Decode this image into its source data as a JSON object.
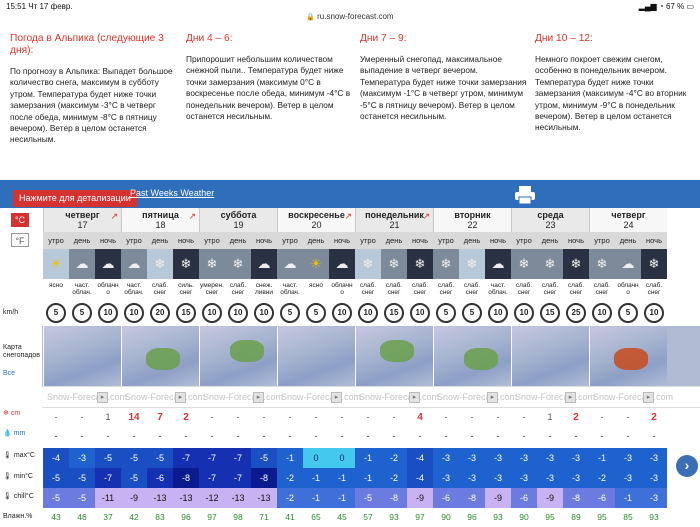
{
  "status": {
    "time": "15:51",
    "date": "Чт 17 февр.",
    "battery": "67 %"
  },
  "url": "ru.snow-forecast.com",
  "intro": [
    {
      "title": "Погода в Альпика (следующие 3 дня):",
      "text": "По прогнозу в Альпика: Выпадет большое количество снега, максимум в субботу утром. Температура будет ниже точки замерзания (максимум -3°C в четверг после обеда, минимум -8°C в пятницу вечером). Ветер в целом останется несильным."
    },
    {
      "title": "Дни 4 – 6:",
      "text": "Припорошит небольшим количеством снежной пыли.. Температура будет ниже точки замерзания (максимум 0°C в воскресенье после обеда, минимум -4°C в понедельник вечером). Ветер в целом останется несильным."
    },
    {
      "title": "Дни 7 – 9:",
      "text": "Умеренный снегопад, максимальное выпадение в четверг вечером. Температура будет ниже точки замерзания (максимум -1°C в четверг утром, минимум -5°C в пятницу вечером). Ветер в целом останется несильным."
    },
    {
      "title": "Дни 10 – 12:",
      "text": "Немного покроет свежим снегом, особенно в понедельник вечером. Температура будет ниже точки замерзания (максимум -4°C во вторник утром, минимум -9°C в понедельник вечером). Ветер в целом останется несильным."
    }
  ],
  "toolbar": {
    "tip": "Нажмите для детализации",
    "past": "Past Weeks Weather"
  },
  "units": {
    "c": "°C",
    "f": "°F"
  },
  "row_labels": {
    "wind": "km/h",
    "map": "Карта снегопадов",
    "map_link": "Все",
    "snow": "cm",
    "rain": "mm",
    "max": "max°C",
    "min": "min°C",
    "chill": "chill°C",
    "hum": "Влажн.%"
  },
  "sf_watermark": "Snow-Forecast.com",
  "days": [
    {
      "name": "четверг",
      "num": "17"
    },
    {
      "name": "пятница",
      "num": "18"
    },
    {
      "name": "суббота",
      "num": "19"
    },
    {
      "name": "воскресенье",
      "num": "20"
    },
    {
      "name": "понедельник",
      "num": "21"
    },
    {
      "name": "вторник",
      "num": "22"
    },
    {
      "name": "среда",
      "num": "23"
    },
    {
      "name": "четверг",
      "num": "24"
    }
  ],
  "tod": [
    "утро",
    "день",
    "ночь"
  ],
  "cond": [
    "ясно",
    "част. облач.",
    "облачн о",
    "част. облач.",
    "слаб. снег",
    "силь. снег",
    "умерен. снег",
    "слаб. снег",
    "снеж. ливни",
    "част. облач.",
    "ясно",
    "облачн о",
    "слаб. снег",
    "слаб. снег",
    "слаб. снег",
    "слаб. снег",
    "слаб. снег",
    "част. облач.",
    "слаб. снег",
    "слаб. снег",
    "слаб. снег",
    "слаб. снег",
    "облачн о",
    "слаб. снег"
  ],
  "wind": [
    "5",
    "5",
    "10",
    "10",
    "20",
    "15",
    "10",
    "10",
    "10",
    "5",
    "5",
    "10",
    "10",
    "15",
    "10",
    "5",
    "5",
    "10",
    "10",
    "15",
    "25",
    "10",
    "5",
    "10"
  ],
  "snow": [
    "-",
    "-",
    "1",
    "14",
    "7",
    "2",
    "-",
    "-",
    "-",
    "-",
    "-",
    "-",
    "-",
    "-",
    "4",
    "-",
    "-",
    "-",
    "-",
    "1",
    "2",
    "-",
    "-",
    "2"
  ],
  "rain": [
    "-",
    "-",
    "-",
    "-",
    "-",
    "-",
    "-",
    "-",
    "-",
    "-",
    "-",
    "-",
    "-",
    "-",
    "-",
    "-",
    "-",
    "-",
    "-",
    "-",
    "-",
    "-",
    "-",
    "-"
  ],
  "tmax": [
    "-4",
    "-3",
    "-5",
    "-5",
    "-5",
    "-7",
    "-7",
    "-7",
    "-5",
    "-1",
    "0",
    "0",
    "-1",
    "-2",
    "-4",
    "-3",
    "-3",
    "-3",
    "-3",
    "-3",
    "-3",
    "-1",
    "-3",
    "-3"
  ],
  "tmin": [
    "-5",
    "-5",
    "-7",
    "-5",
    "-6",
    "-8",
    "-7",
    "-7",
    "-8",
    "-2",
    "-1",
    "-1",
    "-1",
    "-2",
    "-4",
    "-3",
    "-3",
    "-3",
    "-3",
    "-3",
    "-3",
    "-2",
    "-3",
    "-3"
  ],
  "tchill": [
    "-5",
    "-5",
    "-11",
    "-9",
    "-13",
    "-13",
    "-12",
    "-13",
    "-13",
    "-2",
    "-1",
    "-1",
    "-5",
    "-8",
    "-9",
    "-6",
    "-8",
    "-9",
    "-6",
    "-9",
    "-8",
    "-6",
    "-1",
    "-3"
  ],
  "hum": [
    "43",
    "46",
    "37",
    "42",
    "83",
    "96",
    "97",
    "98",
    "71",
    "41",
    "65",
    "45",
    "57",
    "93",
    "97",
    "90",
    "96",
    "93",
    "90",
    "95",
    "89",
    "95",
    "85",
    "93"
  ],
  "colors": {
    "accent": "#d53232",
    "bar": "#2f6ebb",
    "green": "#2e8b2e"
  }
}
